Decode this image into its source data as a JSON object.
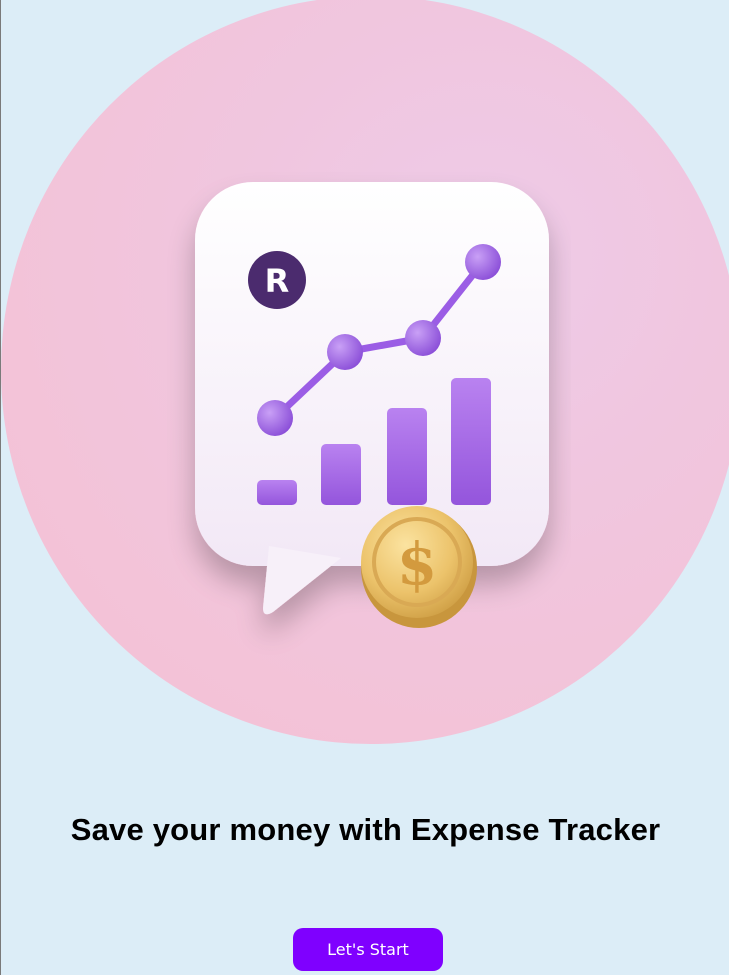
{
  "app": {
    "headline": "Save your money with Expense Tracker",
    "start_button_label": "Let's Start"
  },
  "illustration": {
    "currency_badge": "R",
    "coin_symbol": "$",
    "icon_name": "finance-chart-chat-bubble-icon"
  },
  "colors": {
    "background": "#dcedf7",
    "hero_circle": "#f3c3d8",
    "accent_purple": "#7f00ff",
    "chart_purple": "#a96ee6",
    "badge_dark": "#4b2b6e",
    "coin_gold": "#e8c06a"
  }
}
